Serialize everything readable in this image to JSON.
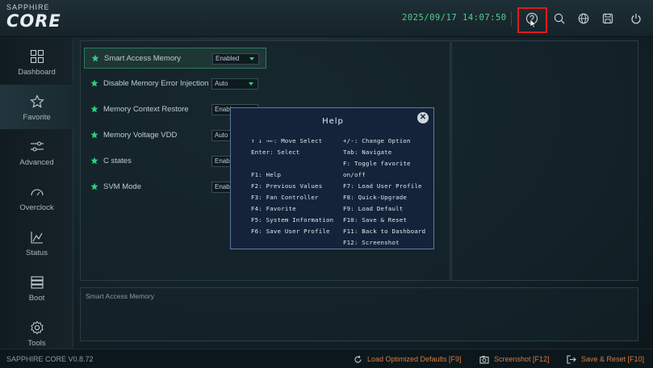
{
  "brand": {
    "top": "SAPPHIRE",
    "main": "CORE"
  },
  "header": {
    "datetime": "2025/09/17 14:07:50",
    "icons": [
      "help-icon",
      "search-icon",
      "globe-icon",
      "save-icon",
      "power-icon"
    ]
  },
  "sidebar": {
    "items": [
      {
        "label": "Dashboard",
        "icon": "dashboard-icon"
      },
      {
        "label": "Favorite",
        "icon": "star-icon"
      },
      {
        "label": "Advanced",
        "icon": "sliders-icon"
      },
      {
        "label": "Overclock",
        "icon": "gauge-icon"
      },
      {
        "label": "Status",
        "icon": "chart-icon"
      },
      {
        "label": "Boot",
        "icon": "boot-icon"
      },
      {
        "label": "Tools",
        "icon": "gear-icon"
      }
    ]
  },
  "options": [
    {
      "label": "Smart Access Memory",
      "value": "Enabled"
    },
    {
      "label": "Disable Memory Error Injection",
      "value": "Auto"
    },
    {
      "label": "Memory Context Restore",
      "value": "Enabl"
    },
    {
      "label": "Memory Voltage VDD",
      "value": "Auto"
    },
    {
      "label": "C states",
      "value": "Enabl"
    },
    {
      "label": "SVM Mode",
      "value": "Enabl"
    }
  ],
  "description": {
    "title": "Smart Access Memory"
  },
  "help": {
    "title": "Help",
    "left": [
      "↑ ↓ →←: Move Select",
      "Enter: Select",
      "F1: Help",
      "F2: Previous Values",
      "F3: Fan Controller",
      "F4: Favorite",
      "F5: System Information",
      "F6: Save User Profile"
    ],
    "right": [
      "+/-: Change Option",
      "Tab: Navigate",
      "F: Toggle favorite",
      "on/off",
      "F7: Load User Profile",
      "F8: Quick-Upgrade",
      "F9: Load Default",
      "F10: Save & Reset",
      "F11: Back to Dashboard",
      "F12: Screenshot"
    ]
  },
  "statusbar": {
    "version": "SAPPHIRE CORE V0.8.72",
    "load_defaults": "Load Optimized Defaults [F9]",
    "screenshot": "Screenshot [F12]",
    "save_reset": "Save & Reset [F10]"
  },
  "colors": {
    "accent": "#28d27c",
    "action": "#d87c3f",
    "highlight": "#e01b1b"
  }
}
